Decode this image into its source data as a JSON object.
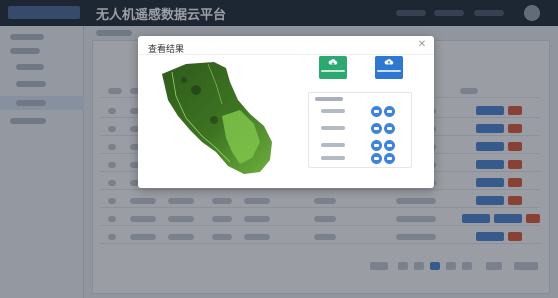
{
  "app": {
    "title": "无人机遥感数据云平台"
  },
  "dialog": {
    "title": "查看结果"
  },
  "colors": {
    "topbar": "#1c2836",
    "download_button": "#2ea871",
    "upload_button": "#2f78d0",
    "row_button": "#3f84d8",
    "table_action_blue": "#4a86d6",
    "table_action_red": "#e0583a",
    "map_dark_green": "#2f5a1c",
    "map_light_green": "#7fc34a"
  },
  "icons": {
    "download": "cloud-download-icon",
    "upload": "cloud-upload-icon",
    "close": "close-icon"
  },
  "panel_rows": 4
}
